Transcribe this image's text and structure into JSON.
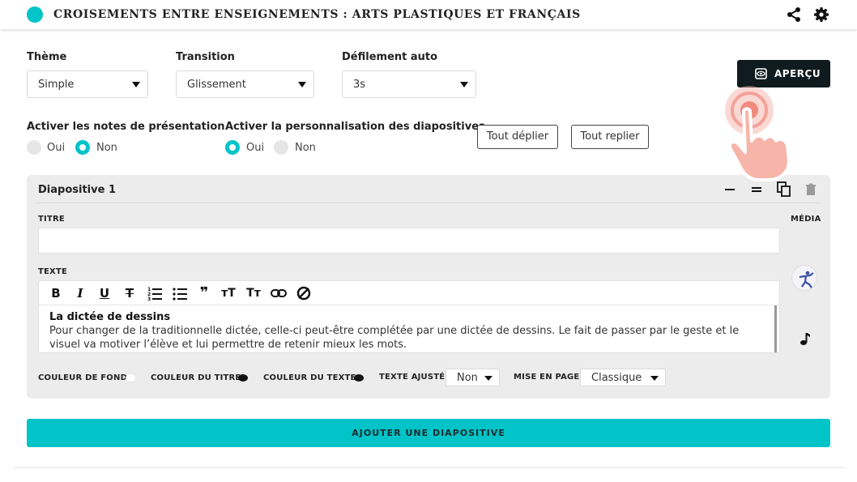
{
  "header": {
    "title": "CROISEMENTS ENTRE ENSEIGNEMENTS : ARTS PLASTIQUES ET FRANÇAIS",
    "share_icon": "share-icon",
    "settings_icon": "gear-icon",
    "accent_color": "#00c4c8"
  },
  "settings": {
    "theme": {
      "label": "Thème",
      "value": "Simple"
    },
    "transition": {
      "label": "Transition",
      "value": "Glissement"
    },
    "autoscroll": {
      "label": "Défilement auto",
      "value": "3s"
    },
    "preview_button": "APERÇU",
    "notes": {
      "label": "Activer les notes de présentation",
      "yes": "Oui",
      "no": "Non",
      "selected": "Non"
    },
    "customize": {
      "label": "Activer la personnalisation des diapositives",
      "yes": "Oui",
      "no": "Non",
      "selected": "Oui"
    },
    "expand_all": "Tout déplier",
    "collapse_all": "Tout replier"
  },
  "slide": {
    "title": "Diapositive 1",
    "titre_label": "TITRE",
    "titre_value": "",
    "media_label": "MÉDIA",
    "texte_label": "TEXTE",
    "toolbar": [
      "B",
      "I",
      "U",
      "S",
      "ol",
      "ul",
      "quote",
      "T-size",
      "Tt",
      "link",
      "unlink"
    ],
    "text_heading": "La dictée de dessins",
    "text_body": "Pour changer de la traditionnelle dictée, celle-ci peut-être complétée par une dictée de dessins. Le fait de passer par le geste et le visuel va motiver l’élève et lui permettre de retenir mieux les mots.",
    "bg_color_label": "COULEUR DE FOND",
    "title_color_label": "COULEUR DU TITRE",
    "text_color_label": "COULEUR DU TEXTE",
    "fit_text_label": "TEXTE AJUSTÉ",
    "fit_text_value": "Non",
    "layout_label": "MISE EN PAGE",
    "layout_value": "Classique",
    "bg_color": "#ffffff",
    "title_color": "#111111",
    "text_color": "#111111"
  },
  "add_slide": "AJOUTER UNE DIAPOSITIVE"
}
